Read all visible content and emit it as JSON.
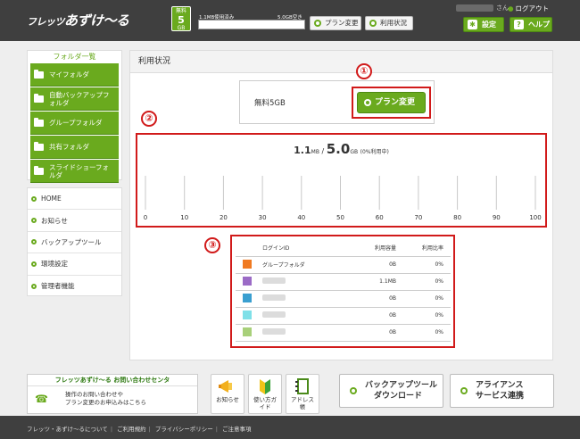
{
  "header": {
    "logo_main": "フレッツ",
    "logo_sub": "あずけ〜る",
    "plan_badge": {
      "top": "無料",
      "size": "5",
      "unit": "GB"
    },
    "usage_used_label": "1.1MB使用済み",
    "usage_free_label": "5.0GB空き",
    "usage_percent": 0,
    "plan_change_label": "プラン変更",
    "usage_status_label": "利用状況",
    "user_suffix": "さん",
    "logout_label": "ログアウト",
    "settings_label": "設定",
    "help_label": "ヘルプ",
    "accent_color": "#6aaa1e"
  },
  "sidebar": {
    "folder_heading": "フォルダ一覧",
    "folders": [
      {
        "label": "マイフォルダ",
        "icon": "folder-icon"
      },
      {
        "label": "自動バックアップフォルダ",
        "icon": "folder-icon"
      },
      {
        "label": "グループフォルダ",
        "icon": "folder-icon"
      },
      {
        "label": "共有フォルダ",
        "icon": "folder-icon"
      },
      {
        "label": "スライドショーフォルダ",
        "icon": "folder-icon"
      }
    ],
    "nav": [
      {
        "label": "HOME"
      },
      {
        "label": "お知らせ"
      },
      {
        "label": "バックアップツール"
      },
      {
        "label": "環境設定"
      },
      {
        "label": "管理者機能"
      }
    ]
  },
  "main": {
    "title": "利用状況",
    "plan_name": "無料5GB",
    "plan_change_button": "プラン変更",
    "gauge": {
      "used_value": "1.1",
      "used_unit": "MB",
      "separator": "/",
      "total_value": "5.0",
      "total_unit": "GB",
      "percent_note": "(0%利用中)",
      "ticks": [
        "0",
        "10",
        "20",
        "30",
        "40",
        "50",
        "60",
        "70",
        "80",
        "90",
        "100"
      ]
    },
    "callouts": [
      "①",
      "②",
      "③"
    ],
    "table": {
      "headers": [
        "ログインID",
        "利用容量",
        "利用比率"
      ],
      "rows": [
        {
          "color": "#f07a21",
          "name": "グループフォルダ",
          "usage": "0B",
          "ratio": "0%"
        },
        {
          "color": "#9b6bc6",
          "name": "",
          "usage": "1.1MB",
          "ratio": "0%"
        },
        {
          "color": "#3a9fd0",
          "name": "",
          "usage": "0B",
          "ratio": "0%"
        },
        {
          "color": "#7fe0e8",
          "name": "",
          "usage": "0B",
          "ratio": "0%"
        },
        {
          "color": "#a8d07a",
          "name": "",
          "usage": "0B",
          "ratio": "0%"
        }
      ]
    }
  },
  "footer": {
    "contact_title": "フレッツあずけ〜る お問い合わせセンタ",
    "contact_line1": "操作のお問い合わせや",
    "contact_line2": "プラン変更のお申込みはこちら",
    "icon_buttons": [
      {
        "label": "お知らせ",
        "icon": "megaphone-icon"
      },
      {
        "label": "使い方ガイド",
        "icon": "beginner-mark-icon"
      },
      {
        "label": "アドレス帳",
        "icon": "address-book-icon"
      }
    ],
    "backup_tool_line1": "バックアップツール",
    "backup_tool_line2": "ダウンロード",
    "alliance_line1": "アライアンス",
    "alliance_line2": "サービス連携",
    "links": [
      "フレッツ・あずけ〜るについて",
      "ご利用規約",
      "プライバシーポリシー",
      "ご注意事項"
    ]
  }
}
